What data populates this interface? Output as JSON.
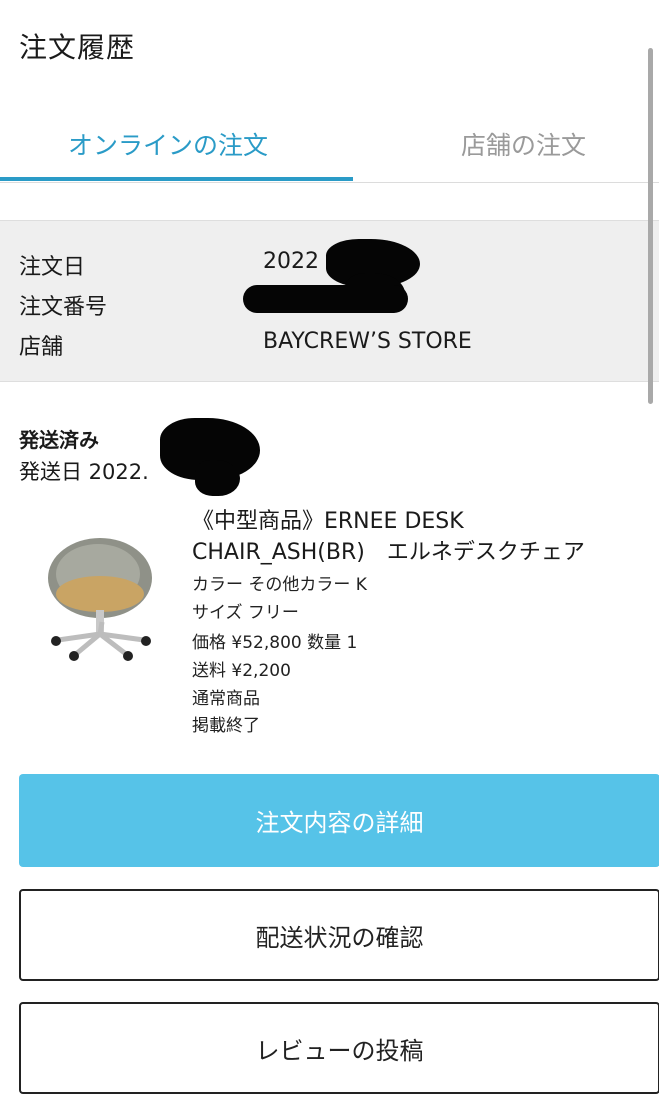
{
  "header": {
    "title": "注文履歴"
  },
  "tabs": [
    {
      "label": "オンラインの注文",
      "active": true
    },
    {
      "label": "店舗の注文",
      "active": false
    }
  ],
  "order_info": {
    "date_label": "注文日",
    "date_value": "2022",
    "number_label": "注文番号",
    "number_value": "",
    "store_label": "店舗",
    "store_value": "BAYCREW’S STORE"
  },
  "shipment": {
    "status": "発送済み",
    "date": "発送日 2022."
  },
  "product": {
    "image_icon": "office-chair-photo",
    "name": "《中型商品》ERNEE DESK CHAIR_ASH(BR)　エルネデスクチェア",
    "color": "カラー その他カラー K",
    "size": "サイズ フリー",
    "price_qty": "価格 ¥52,800 数量 1",
    "shipping": "送料 ¥2,200",
    "type": "通常商品",
    "listing": "掲載終了"
  },
  "buttons": {
    "detail": "注文内容の詳細",
    "shipping_status": "配送状況の確認",
    "review": "レビューの投稿"
  },
  "colors": {
    "accent": "#2a9bc7",
    "primary_button": "#56c3e8",
    "info_background": "#efefef"
  }
}
